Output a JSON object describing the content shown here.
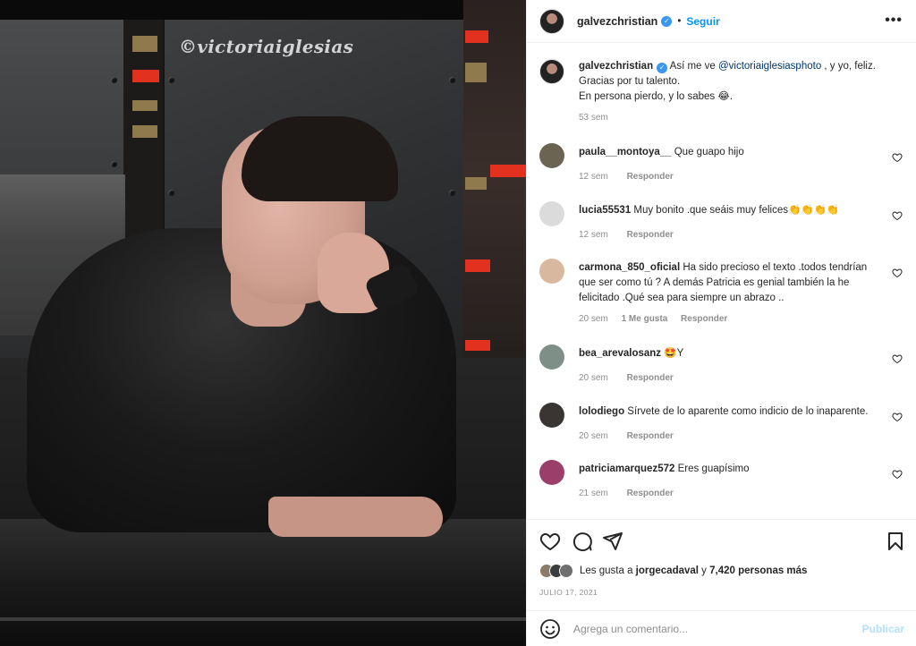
{
  "photo": {
    "watermark": "©victoriaiglesias",
    "alt_subject": "portrait"
  },
  "header": {
    "username": "galvezchristian",
    "separator": "•",
    "follow_label": "Seguir",
    "more_label": "•••"
  },
  "caption": {
    "username": "galvezchristian",
    "text_before": " Así me ve ",
    "mention": "@victoriaiglesiasphoto",
    "text_after": " , y yo, feliz. Gracias por tu talento.",
    "line2": "En persona pierdo, y lo sabes 😂.",
    "time": "53 sem"
  },
  "comments": [
    {
      "username": "paula__montoya__",
      "text": " Que guapo hijo",
      "time": "12 sem",
      "likes": "",
      "reply": "Responder",
      "avatar_color": "#6b6453"
    },
    {
      "username": "lucia55531",
      "text": " Muy bonito .que seáis muy felices👏👏👏👏",
      "time": "12 sem",
      "likes": "",
      "reply": "Responder",
      "avatar_color": "#dbdbdb"
    },
    {
      "username": "carmona_850_oficial",
      "text": " Ha sido precioso el texto .todos tendrían que ser como tú ? A demás Patricia es genial también la he felicitado .Qué sea para siempre un abrazo ..",
      "time": "20 sem",
      "likes": "1 Me gusta",
      "reply": "Responder",
      "avatar_color": "#d9b8a0"
    },
    {
      "username": "bea_arevalosanz",
      "text": " 🤩Y",
      "time": "20 sem",
      "likes": "",
      "reply": "Responder",
      "avatar_color": "#7d8f86"
    },
    {
      "username": "lolodiego",
      "text": " Sírvete de lo aparente como indicio de lo inaparente.",
      "time": "20 sem",
      "likes": "",
      "reply": "Responder",
      "avatar_color": "#3a3533"
    },
    {
      "username": "patriciamarquez572",
      "text": " Eres guapísimo",
      "time": "21 sem",
      "likes": "",
      "reply": "Responder",
      "avatar_color": "#9b3e6a"
    }
  ],
  "likes": {
    "prefix": "Les gusta a ",
    "user": "jorgecadaval",
    "middle": " y ",
    "count": "7,420 personas más"
  },
  "date": "JULIO 17, 2021",
  "compose": {
    "placeholder": "Agrega un comentario...",
    "publish_label": "Publicar"
  },
  "icons": [
    "heart-icon",
    "comment-icon",
    "share-icon",
    "bookmark-icon",
    "emoji-icon",
    "verified-icon",
    "more-icon"
  ]
}
